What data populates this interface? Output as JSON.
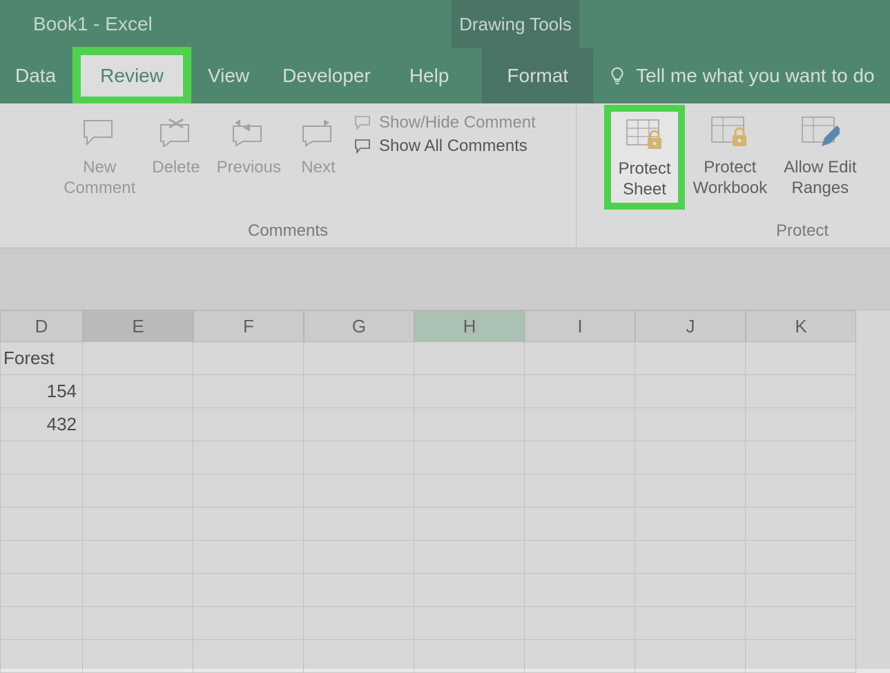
{
  "title": "Book1  -  Excel",
  "contextual_tab": "Drawing Tools",
  "tabs": {
    "data": "Data",
    "review": "Review",
    "view": "View",
    "developer": "Developer",
    "help": "Help",
    "format": "Format"
  },
  "tellme": {
    "placeholder": "Tell me what you want to do"
  },
  "ribbon": {
    "comments": {
      "new_comment": "New\nComment",
      "delete": "Delete",
      "previous": "Previous",
      "next": "Next",
      "show_hide": "Show/Hide Comment",
      "show_all": "Show All Comments",
      "group_label": "Comments"
    },
    "protect": {
      "protect_sheet": "Protect\nSheet",
      "protect_workbook": "Protect\nWorkbook",
      "allow_edit_ranges": "Allow Edit\nRanges",
      "group_label": "Protect"
    }
  },
  "columns": [
    "D",
    "E",
    "F",
    "G",
    "H",
    "I",
    "J",
    "K"
  ],
  "selected_col": "E",
  "active_col": "H",
  "rows": [
    {
      "D": "Forest"
    },
    {
      "D": "154"
    },
    {
      "D": "432"
    },
    {},
    {},
    {},
    {},
    {},
    {},
    {}
  ]
}
